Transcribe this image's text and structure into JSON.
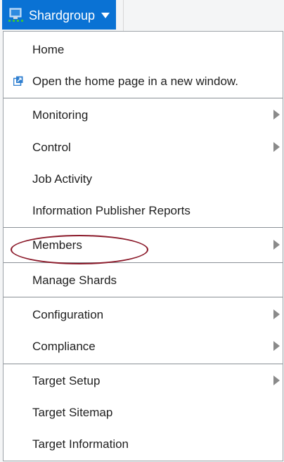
{
  "header": {
    "target_label": "Shardgroup",
    "target_icon": "target-computer-icon",
    "dropdown_icon": "caret-down-icon",
    "accent_color": "#0a72d4"
  },
  "menu": {
    "items": [
      {
        "label": "Home",
        "has_submenu": false
      },
      {
        "label": "Open the home page in a new window.",
        "icon": "new-window-icon",
        "has_submenu": false
      },
      {
        "label": "Monitoring",
        "has_submenu": true
      },
      {
        "label": "Control",
        "has_submenu": true
      },
      {
        "label": "Job Activity",
        "has_submenu": false
      },
      {
        "label": "Information Publisher Reports",
        "has_submenu": false
      },
      {
        "label": "Members",
        "has_submenu": true
      },
      {
        "label": "Manage Shards",
        "has_submenu": false,
        "highlighted": true
      },
      {
        "label": "Configuration",
        "has_submenu": true
      },
      {
        "label": "Compliance",
        "has_submenu": true
      },
      {
        "label": "Target Setup",
        "has_submenu": true
      },
      {
        "label": "Target Sitemap",
        "has_submenu": false
      },
      {
        "label": "Target Information",
        "has_submenu": false
      }
    ],
    "highlight_color": "#8b1a2a"
  }
}
